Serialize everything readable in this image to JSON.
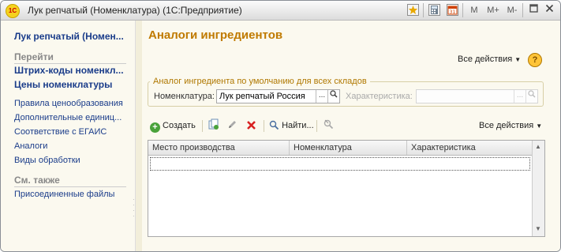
{
  "window": {
    "title": "Лук репчатый (Номенклатура) (1С:Предприятие)",
    "logo": "1С",
    "toolbar": {
      "m": "M",
      "m_plus": "M+",
      "m_minus": "M-"
    }
  },
  "sidebar": {
    "header": "Лук репчатый (Номен...",
    "goto_title": "Перейти",
    "goto_links": [
      "Штрих-коды номенкл...",
      "Цены номенклатуры"
    ],
    "items": [
      "Правила ценообразования",
      "Дополнительные единиц...",
      "Соответствие с ЕГАИС",
      "Аналоги",
      "Виды обработки"
    ],
    "see_also_title": "См. также",
    "see_also_items": [
      "Присоединенные файлы"
    ]
  },
  "main": {
    "title": "Аналоги ингредиентов",
    "all_actions": "Все действия",
    "help": "?",
    "group": {
      "caption": "Аналог ингредиента по умолчанию для всех складов",
      "nomenclature_label": "Номенклатура:",
      "nomenclature_value": "Лук репчатый Россия",
      "characteristic_label": "Характеристика:",
      "characteristic_value": ""
    },
    "list_toolbar": {
      "create": "Создать",
      "find": "Найти...",
      "all_actions": "Все действия"
    },
    "table": {
      "columns": [
        "Место производства",
        "Номенклатура",
        "Характеристика"
      ],
      "rows": []
    }
  }
}
